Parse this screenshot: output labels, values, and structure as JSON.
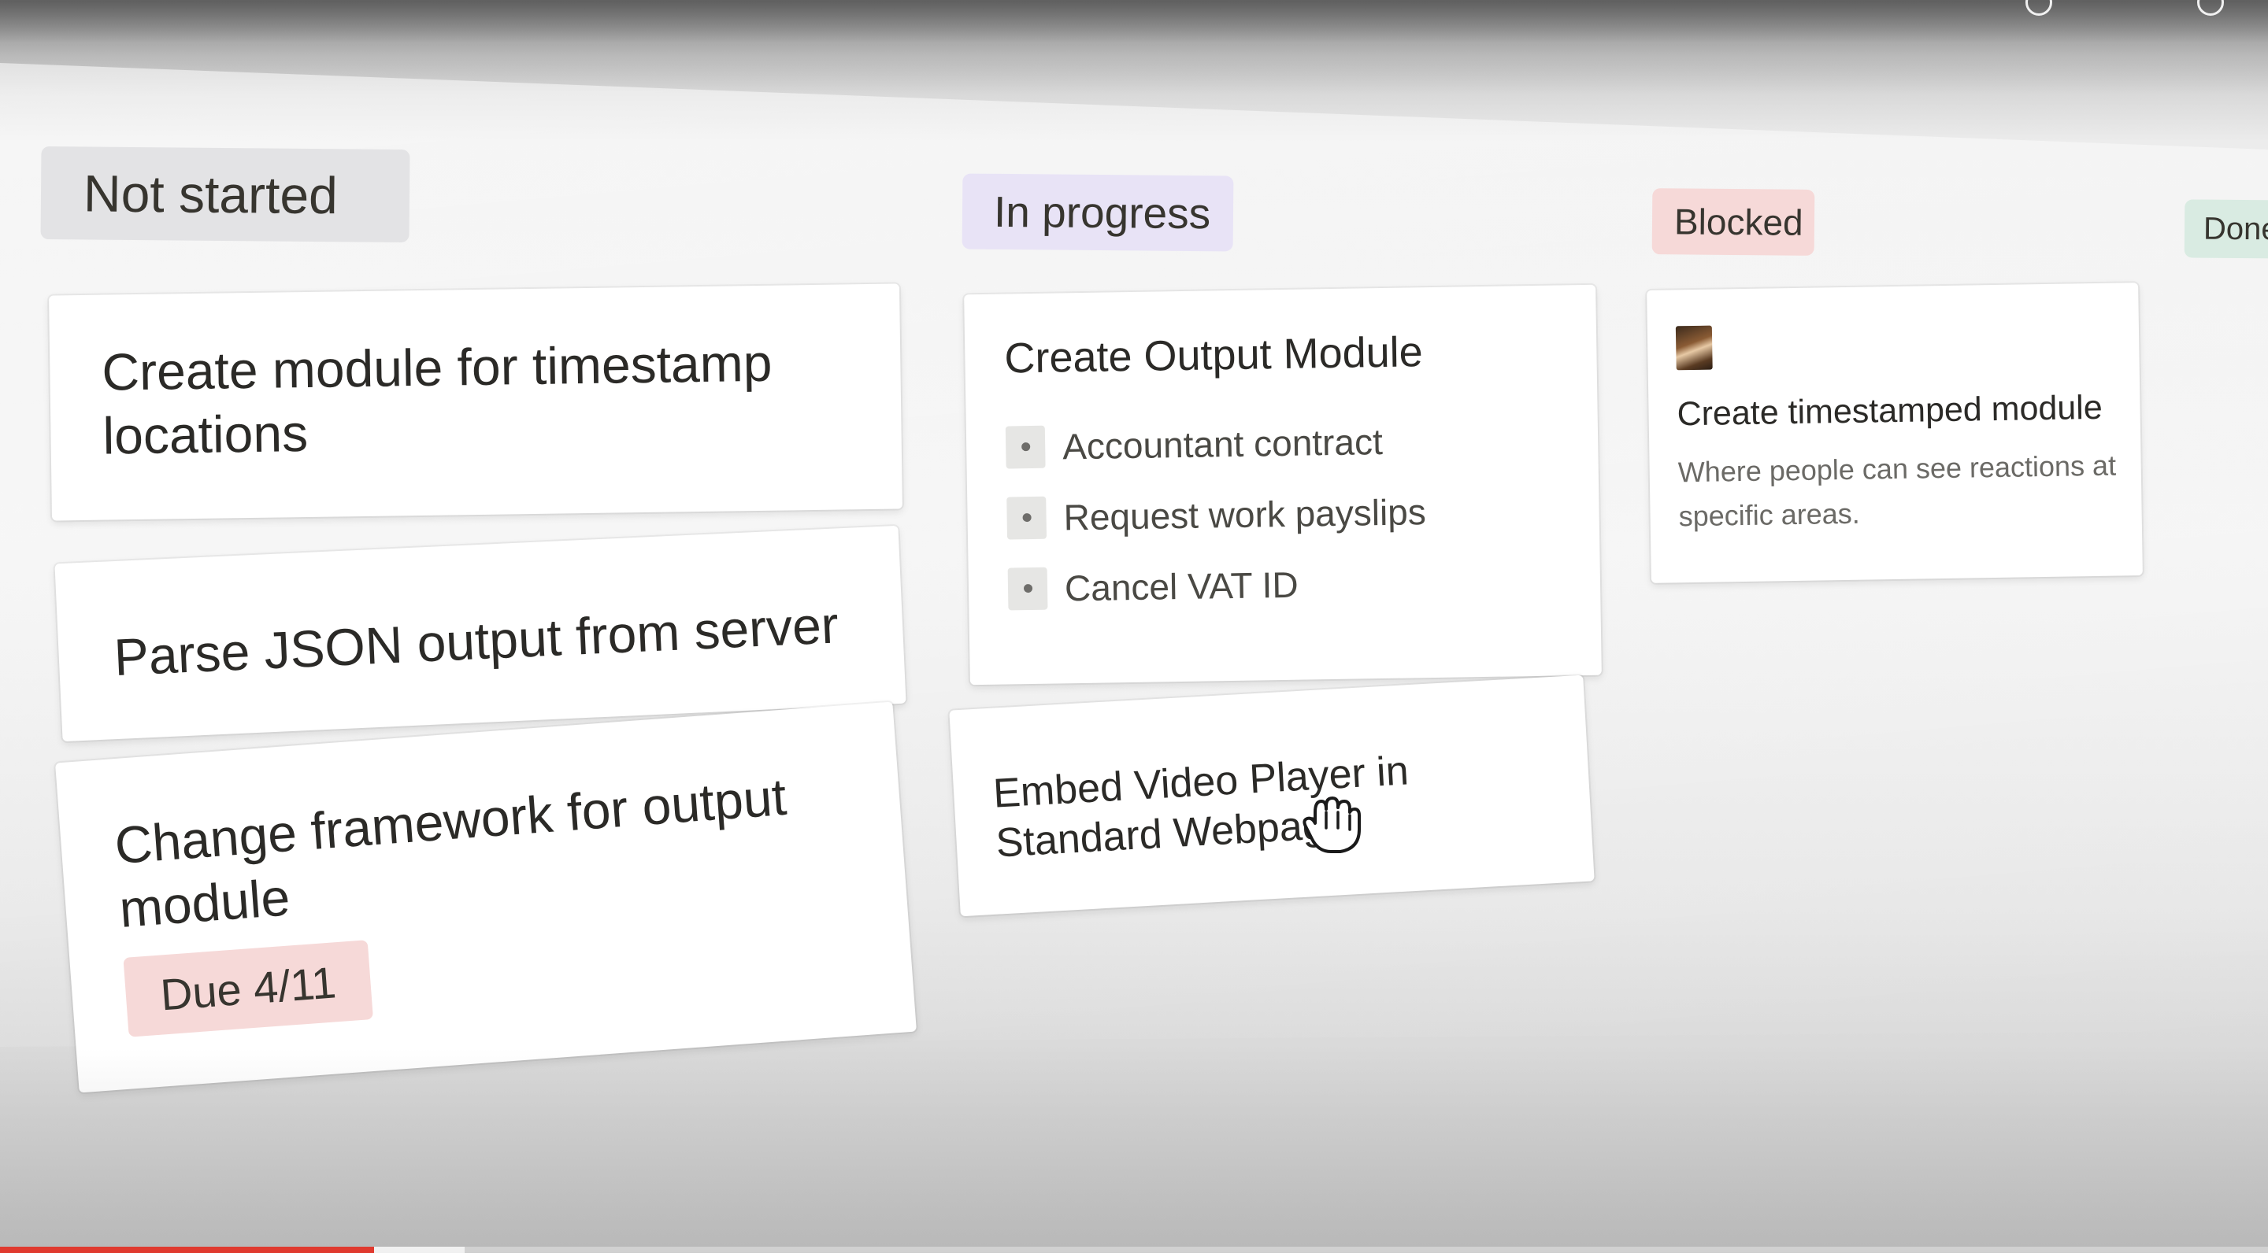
{
  "board": {
    "columns": [
      {
        "label": "Not started",
        "color": "#e3e3e5",
        "cards": [
          {
            "title": "Create module for timestamp locations"
          },
          {
            "title": "Parse JSON output from server"
          },
          {
            "title": "Change framework for output module",
            "badge": "Due 4/11"
          }
        ]
      },
      {
        "label": "In progress",
        "color": "#e8e3f6",
        "cards": [
          {
            "title": "Create Output Module",
            "checklist": [
              "Accountant contract",
              "Request work payslips",
              "Cancel VAT ID"
            ]
          },
          {
            "title": "Embed Video Player in Standard Webpage"
          }
        ]
      },
      {
        "label": "Blocked",
        "color": "#f6d9d8",
        "cards": [
          {
            "title": "Create timestamped module",
            "description": "Where people can see reactions at specific areas.",
            "avatar_icon": "user-avatar-icon"
          }
        ]
      },
      {
        "label": "Done",
        "color": "#d9ebe2",
        "cards": []
      }
    ]
  },
  "cursor_icon": "grab-hand-icon",
  "video_progress": {
    "played_fraction": 0.165,
    "loaded_fraction": 0.205,
    "color": "#e03a2f"
  }
}
